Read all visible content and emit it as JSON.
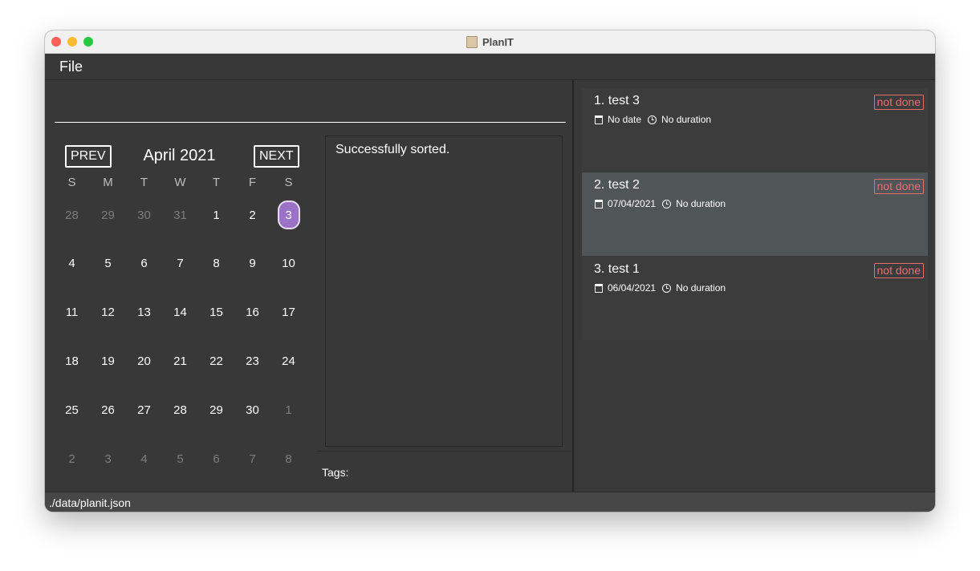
{
  "window": {
    "title": "PlanIT"
  },
  "menu": {
    "file_label": "File"
  },
  "command": {
    "value": ""
  },
  "calendar": {
    "prev_label": "PREV",
    "next_label": "NEXT",
    "month_label": "April 2021",
    "weekdays": [
      "S",
      "M",
      "T",
      "W",
      "T",
      "F",
      "S"
    ],
    "weeks": [
      [
        "28",
        "29",
        "30",
        "31",
        "1",
        "2",
        "3"
      ],
      [
        "4",
        "5",
        "6",
        "7",
        "8",
        "9",
        "10"
      ],
      [
        "11",
        "12",
        "13",
        "14",
        "15",
        "16",
        "17"
      ],
      [
        "18",
        "19",
        "20",
        "21",
        "22",
        "23",
        "24"
      ],
      [
        "25",
        "26",
        "27",
        "28",
        "29",
        "30",
        "1"
      ],
      [
        "2",
        "3",
        "4",
        "5",
        "6",
        "7",
        "8"
      ]
    ],
    "today": "3",
    "today_color": "#9b72c7"
  },
  "result": {
    "message": "Successfully sorted."
  },
  "tags": {
    "label": "Tags:"
  },
  "tasks": [
    {
      "title": "1.  test 3",
      "status": "not done",
      "date": "No date",
      "duration": "No duration"
    },
    {
      "title": "2.  test 2",
      "status": "not done",
      "date": "07/04/2021",
      "duration": "No duration",
      "selected": true
    },
    {
      "title": "3.  test 1",
      "status": "not done",
      "date": "06/04/2021",
      "duration": "No duration"
    }
  ],
  "colors": {
    "status_not_done": "#e86e6e",
    "selected_card": "#505558"
  },
  "statusbar": {
    "path": "./data/planit.json"
  }
}
